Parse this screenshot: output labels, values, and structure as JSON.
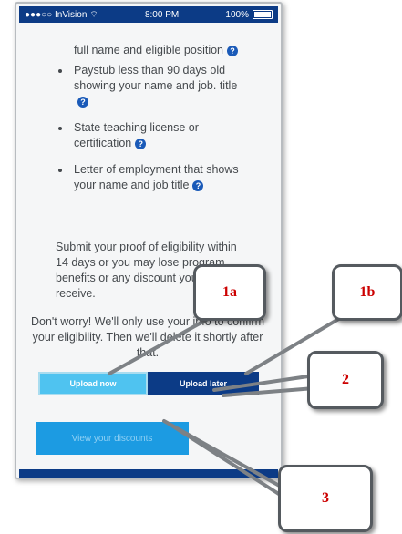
{
  "status": {
    "carrier": "●●●○○ InVision",
    "time": "8:00 PM",
    "battery": "100%"
  },
  "content": {
    "partial_line": "full name and eligible position",
    "items": [
      "Paystub less than 90 days old showing your name and job. title",
      "State teaching license or certification",
      "Letter of employment that shows your name and job title"
    ],
    "notice": "Submit your proof of eligibility within 14 days or you may lose program benefits or any discount you might receive.",
    "worry": "Don't worry! We'll only use your info to confirm your eligibility. Then we'll delete it shortly after that."
  },
  "buttons": {
    "upload_now": "Upload now",
    "upload_later": "Upload later",
    "view_discounts": "View your discounts"
  },
  "callouts": {
    "c1a": "1a",
    "c1b": "1b",
    "c2": "2",
    "c3": "3"
  },
  "colors": {
    "brand_navy": "#0c3b86",
    "light_blue": "#4fc3f0",
    "button_blue": "#1c9be2",
    "callout_text": "#cc0000"
  }
}
